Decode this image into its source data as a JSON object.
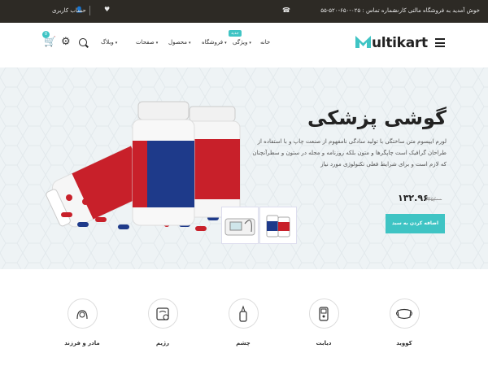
{
  "topbar": {
    "welcome": "خوش آمدید به فروشگاه مالتی کارت",
    "phone": "شماره تماس : ۰۲۵-۶۵۰-۵۲۰-۵۵",
    "account": "حساب کاربری"
  },
  "header": {
    "logo_text": "ultikart",
    "nav": {
      "home": "خانه",
      "features": "ویژگی",
      "shop": "فروشگاه",
      "product": "محصول",
      "pages": "صفحات",
      "blog": "وبلاگ"
    },
    "new_badge": "جدید",
    "cart_count": "0"
  },
  "hero": {
    "title": "گوشی پزشکی",
    "description": "لورم ایپسوم متن ساختگی با تولید سادگی نامفهوم از صنعت چاپ و با استفاده از طراحان گرافیک است چاپگرها و متون بلکه روزنامه و مجله در ستون و سطرآنچنان که لازم است و برای شرایط فعلی تکنولوژی مورد نیاز",
    "price_old": "۱۴۵/۰۰",
    "price_new": "۱۳۲.۹۶",
    "cta": "اضافه کردن به سبد"
  },
  "categories": [
    {
      "label": "کووید",
      "icon": "mask-icon"
    },
    {
      "label": "دیابت",
      "icon": "glucometer-icon"
    },
    {
      "label": "چشم",
      "icon": "eye-drops-icon"
    },
    {
      "label": "رژیم",
      "icon": "diet-scale-icon"
    },
    {
      "label": "مادر و فرزند",
      "icon": "mother-child-icon"
    }
  ],
  "colors": {
    "accent": "#3fc4c4",
    "topbar_bg": "#2d2a25",
    "hero_bg": "#eef3f5",
    "bottle_red": "#c8202a",
    "bottle_blue": "#1e3a8a"
  }
}
